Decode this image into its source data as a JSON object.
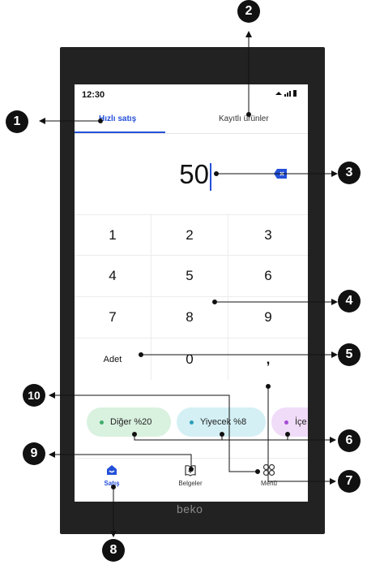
{
  "status": {
    "time": "12:30",
    "icons_text": "◆ .┃┃▉"
  },
  "tabs": [
    {
      "label": "Hızlı satış",
      "active": true
    },
    {
      "label": "Kayıtlı ürünler",
      "active": false
    }
  ],
  "amount": "50",
  "keypad": {
    "keys": [
      "1",
      "2",
      "3",
      "4",
      "5",
      "6",
      "7",
      "8",
      "9",
      "Adet",
      "0",
      ","
    ]
  },
  "categories": [
    {
      "label": "Diğer %20",
      "color": "#3fae6a",
      "bg": "#d9f1df"
    },
    {
      "label": "Yiyecek %8",
      "color": "#2aa0b8",
      "bg": "#d4f0f4"
    },
    {
      "label": "İçe",
      "color": "#a64bd6",
      "bg": "#f0dcf8"
    }
  ],
  "nav": [
    {
      "label": "Satış",
      "icon": "home-icon",
      "active": true
    },
    {
      "label": "Belgeler",
      "icon": "book-icon",
      "active": false
    },
    {
      "label": "Menü",
      "icon": "grid-icon",
      "active": false
    }
  ],
  "brand": "beko",
  "callouts": [
    "1",
    "2",
    "3",
    "4",
    "5",
    "6",
    "7",
    "8",
    "9",
    "10"
  ],
  "colors": {
    "accent": "#2450d8",
    "device": "#222222"
  }
}
